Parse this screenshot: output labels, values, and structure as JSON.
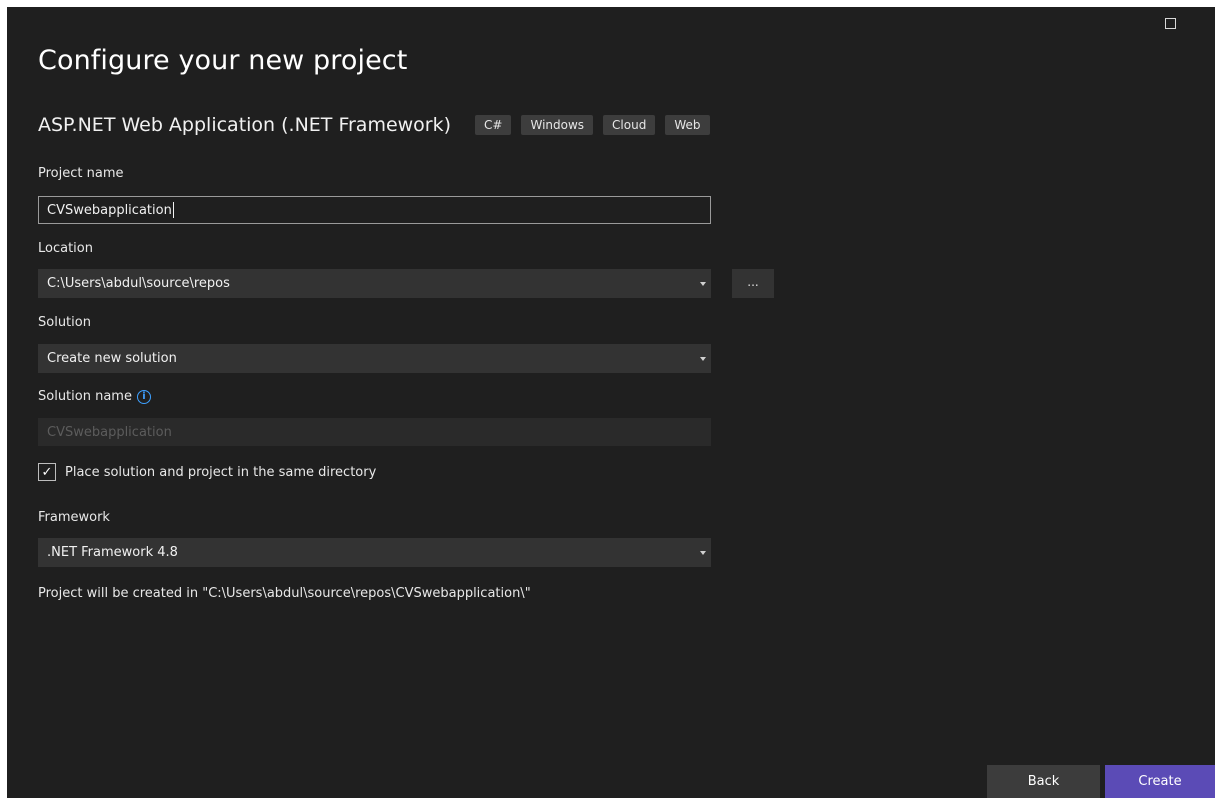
{
  "window": {
    "maximize_icon": "maximize-icon"
  },
  "header": {
    "title": "Configure your new project",
    "template_name": "ASP.NET Web Application (.NET Framework)",
    "tags": [
      "C#",
      "Windows",
      "Cloud",
      "Web"
    ]
  },
  "form": {
    "project_name": {
      "label": "Project name",
      "value": "CVSwebapplication"
    },
    "location": {
      "label": "Location",
      "value": "C:\\Users\\abdul\\source\\repos",
      "browse_label": "..."
    },
    "solution": {
      "label": "Solution",
      "value": "Create new solution"
    },
    "solution_name": {
      "label": "Solution name",
      "value": "CVSwebapplication",
      "info_icon": "info-icon"
    },
    "same_directory": {
      "label": "Place solution and project in the same directory",
      "checked": true,
      "check_glyph": "✓"
    },
    "framework": {
      "label": "Framework",
      "value": ".NET Framework 4.8"
    },
    "summary": "Project will be created in \"C:\\Users\\abdul\\source\\repos\\CVSwebapplication\\\""
  },
  "footer": {
    "back_label": "Back",
    "create_label": "Create"
  },
  "colors": {
    "background": "#1f1f1f",
    "accent": "#5b4bb6",
    "info": "#3ea0ff"
  }
}
